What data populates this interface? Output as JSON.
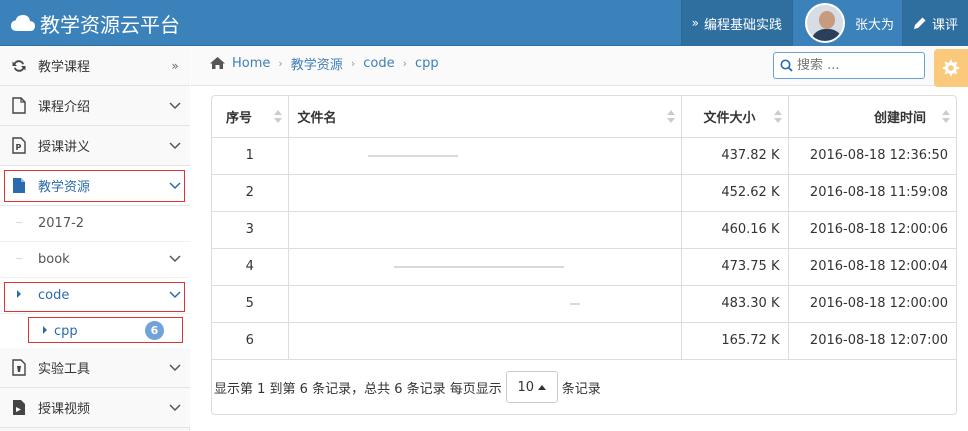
{
  "header": {
    "title": "教学资源云平台",
    "nav_course": "编程基础实践",
    "user_name": "张大为",
    "review": "课评"
  },
  "sidebar": {
    "items": [
      {
        "label": "教学课程",
        "icon": "refresh-icon",
        "arrow": "»"
      },
      {
        "label": "课程介绍",
        "icon": "file-icon",
        "arrow": "⌄"
      },
      {
        "label": "授课讲义",
        "icon": "powerpoint-icon",
        "arrow": "⌄"
      },
      {
        "label": "教学资源",
        "icon": "document-icon",
        "arrow": "⌄"
      },
      {
        "label": "实验工具",
        "icon": "tool-file-icon",
        "arrow": "⌄"
      },
      {
        "label": "授课视频",
        "icon": "video-icon",
        "arrow": "⌄"
      }
    ],
    "sub_items": [
      {
        "label": "2017-2"
      },
      {
        "label": "book"
      },
      {
        "label": "code"
      },
      {
        "label": "cpp",
        "badge": "6"
      }
    ]
  },
  "breadcrumb": {
    "items": [
      "Home",
      "教学资源",
      "code",
      "cpp"
    ]
  },
  "search": {
    "placeholder": "搜索 ..."
  },
  "table": {
    "headers": [
      "序号",
      "文件名",
      "文件大小",
      "创建时间"
    ],
    "rows": [
      {
        "no": "1",
        "size": "437.82 K",
        "created": "2016-08-18 12:36:50"
      },
      {
        "no": "2",
        "size": "452.62 K",
        "created": "2016-08-18 11:59:08"
      },
      {
        "no": "3",
        "size": "460.16 K",
        "created": "2016-08-18 12:00:06"
      },
      {
        "no": "4",
        "size": "473.75 K",
        "created": "2016-08-18 12:00:04"
      },
      {
        "no": "5",
        "size": "483.30 K",
        "created": "2016-08-18 12:00:00"
      },
      {
        "no": "6",
        "size": "165.72 K",
        "created": "2016-08-18 12:07:00"
      }
    ]
  },
  "footer": {
    "summary": "显示第 1 到第 6 条记录，总共 6 条记录 每页显示",
    "page_size": "10",
    "suffix": "条记录"
  }
}
